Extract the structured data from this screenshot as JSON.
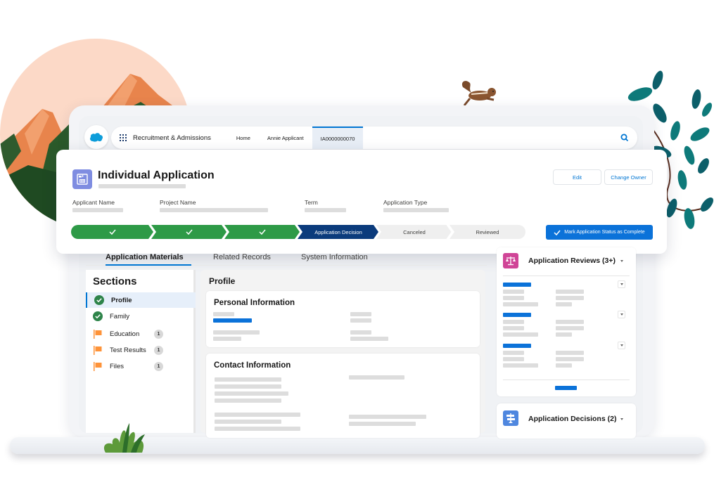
{
  "nav": {
    "app_name": "Recruitment & Admissions",
    "tabs": [
      {
        "label": "Home",
        "active": false
      },
      {
        "label": "Annie Applicant",
        "active": false
      },
      {
        "label": "IA0000000070",
        "active": true
      }
    ],
    "search_icon": "search-icon",
    "brand_color": "#0176d3"
  },
  "record": {
    "object_label": "Individual Application",
    "icon": "application-calendar-icon",
    "fields": [
      {
        "label": "Applicant Name"
      },
      {
        "label": "Project Name"
      },
      {
        "label": "Term"
      },
      {
        "label": "Application Type"
      }
    ],
    "buttons": {
      "edit": "Edit",
      "change_owner": "Change Owner"
    },
    "path": {
      "steps": [
        {
          "label": "",
          "status": "complete"
        },
        {
          "label": "",
          "status": "complete"
        },
        {
          "label": "",
          "status": "complete"
        },
        {
          "label": "Application Decision",
          "status": "current"
        },
        {
          "label": "Canceled",
          "status": "incomplete"
        },
        {
          "label": "Reviewed",
          "status": "incomplete"
        }
      ],
      "complete_color": "#2e9a47",
      "current_color": "#0b3b7c"
    },
    "mark_complete_label": "Mark Application Status as Complete"
  },
  "tabs": [
    {
      "label": "Application Materials",
      "active": true
    },
    {
      "label": "Related Records",
      "active": false
    },
    {
      "label": "System Information",
      "active": false
    }
  ],
  "sections": {
    "title": "Sections",
    "items": [
      {
        "label": "Profile",
        "status": "complete",
        "icon": "check-circle-icon",
        "active": true
      },
      {
        "label": "Family",
        "status": "complete",
        "icon": "check-circle-icon",
        "active": false
      },
      {
        "label": "Education",
        "status": "flagged",
        "icon": "flag-icon",
        "count": "1",
        "active": false
      },
      {
        "label": "Test Results",
        "status": "flagged",
        "icon": "flag-icon",
        "count": "1",
        "active": false
      },
      {
        "label": "Files",
        "status": "flagged",
        "icon": "flag-icon",
        "count": "1",
        "active": false
      }
    ]
  },
  "profile": {
    "title": "Profile",
    "cards": [
      {
        "title": "Personal Information"
      },
      {
        "title": "Contact Information"
      }
    ]
  },
  "related": {
    "reviews": {
      "title": "Application Reviews (3+)",
      "icon": "scales-icon",
      "icon_color": "#d04597",
      "item_count": 3
    },
    "decisions": {
      "title": "Application Decisions (2)",
      "icon": "signpost-icon",
      "icon_color": "#4f87df"
    }
  }
}
